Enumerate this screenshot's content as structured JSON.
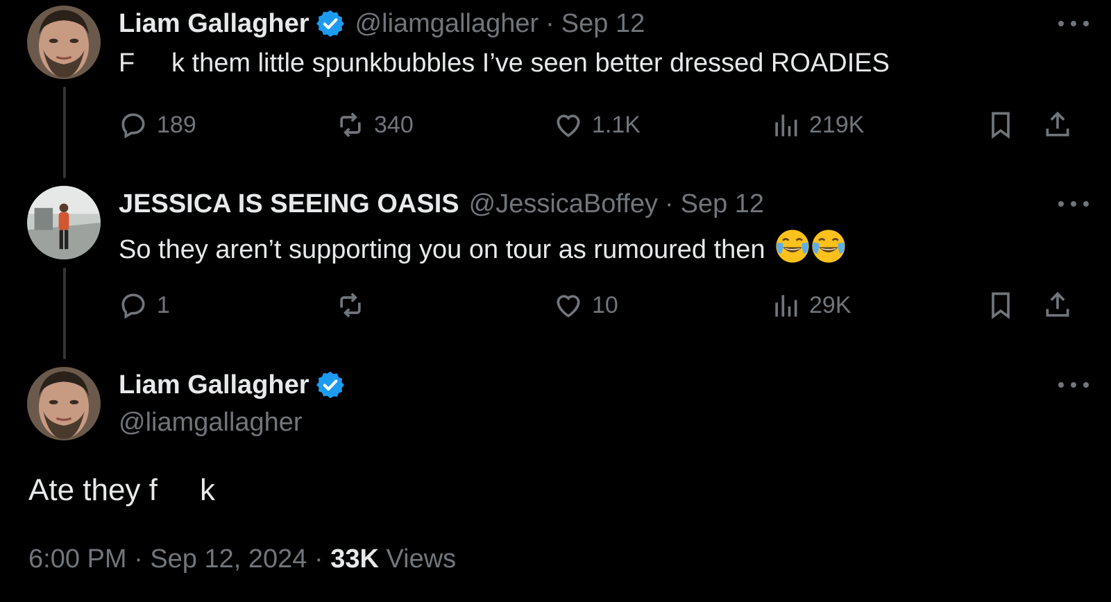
{
  "colors": {
    "background": "#000000",
    "primary_text": "#e7e9ea",
    "secondary_text": "#71767b",
    "verified_blue": "#1d9bf0",
    "thread_line": "#333639"
  },
  "tweet1": {
    "avatar_icon": "avatar-liam",
    "name": "Liam Gallagher",
    "verified": true,
    "handle": "@liamgallagher",
    "separator": "·",
    "date": "Sep 12",
    "text": "F     k them little spunkbubbles I’ve seen better dressed ROADIES",
    "replies": "189",
    "reposts": "340",
    "likes": "1.1K",
    "views": "219K"
  },
  "tweet2": {
    "avatar_icon": "avatar-jessica",
    "name": "JESSICA IS SEEING OASIS",
    "handle": "@JessicaBoffey",
    "separator": "·",
    "date": "Sep 12",
    "text": "So they aren’t supporting you on tour as rumoured then",
    "emojis": [
      "face-with-tears-of-joy",
      "face-with-tears-of-joy"
    ],
    "replies": "1",
    "reposts": "",
    "likes": "10",
    "views": "29K"
  },
  "tweet3": {
    "avatar_icon": "avatar-liam",
    "name": "Liam Gallagher",
    "verified": true,
    "handle": "@liamgallagher",
    "text": "Ate they f     k",
    "time": "6:00 PM",
    "separator": "·",
    "full_date": "Sep 12, 2024",
    "views_count": "33K",
    "views_label": "Views"
  }
}
